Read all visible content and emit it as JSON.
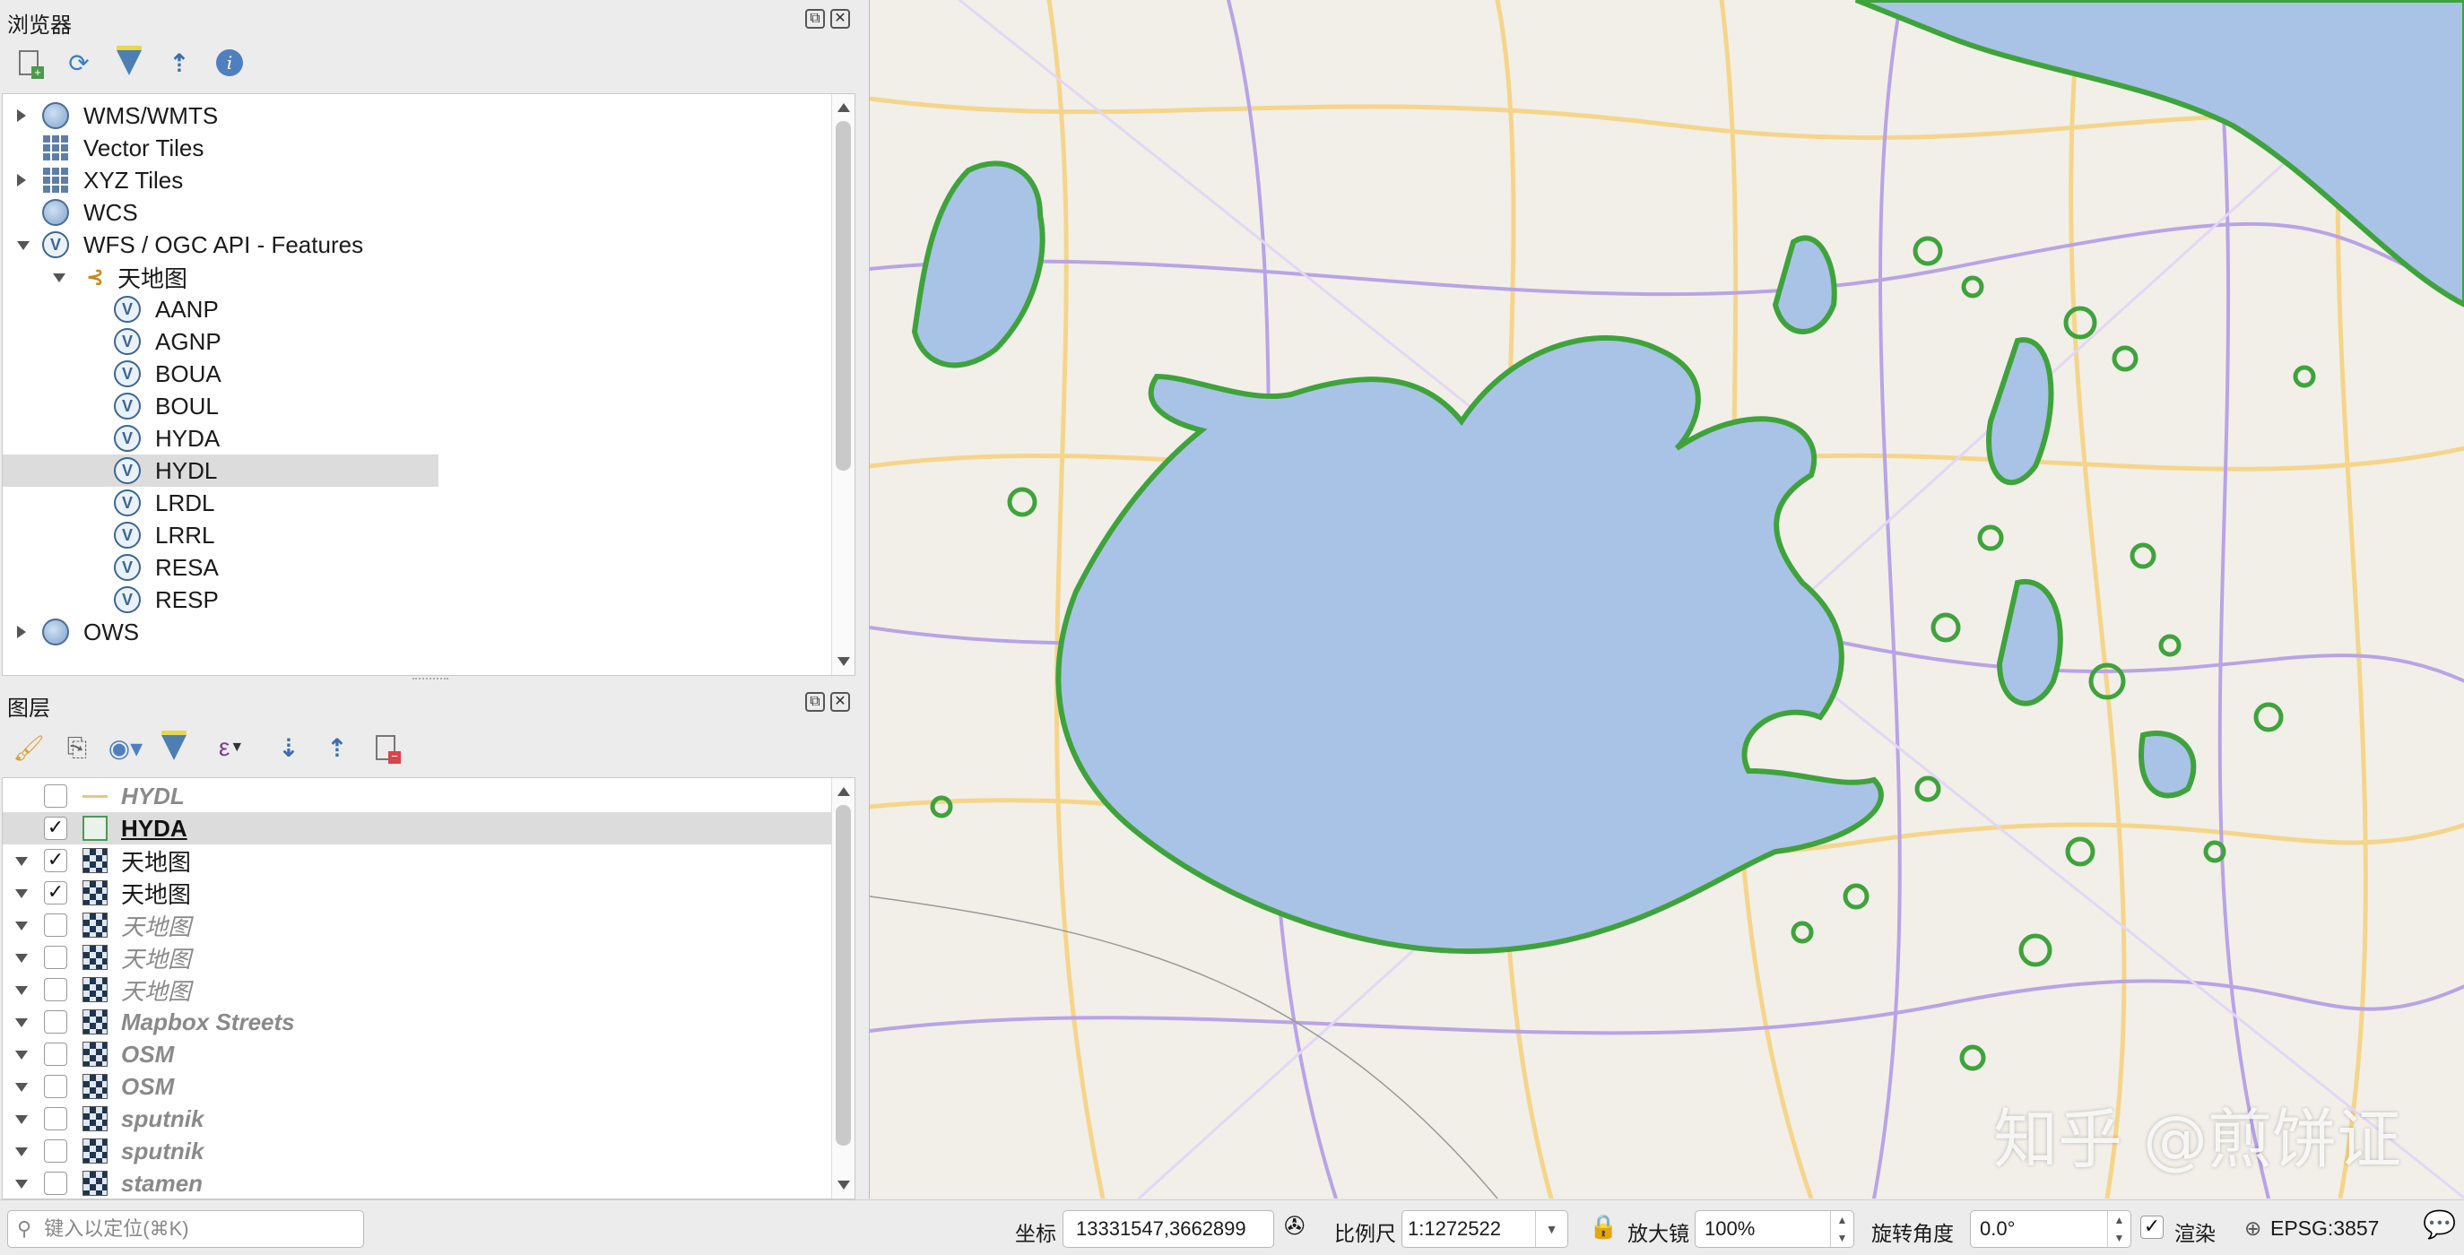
{
  "browser": {
    "title": "浏览器",
    "toolbar": [
      "add-selected-layers-icon",
      "refresh-icon",
      "filter-icon",
      "collapse-all-icon",
      "properties-icon"
    ],
    "items": [
      {
        "label": "WMS/WMTS",
        "icon": "globe",
        "expand": "right",
        "indent": 0
      },
      {
        "label": "Vector Tiles",
        "icon": "grid",
        "expand": "",
        "indent": 0
      },
      {
        "label": "XYZ Tiles",
        "icon": "grid",
        "expand": "right",
        "indent": 0
      },
      {
        "label": "WCS",
        "icon": "globe",
        "expand": "",
        "indent": 0
      },
      {
        "label": "WFS / OGC API - Features",
        "icon": "wfs",
        "expand": "down",
        "indent": 0
      },
      {
        "label": "天地图",
        "icon": "connection",
        "expand": "down",
        "indent": 1
      },
      {
        "label": "AANP",
        "icon": "wfs",
        "indent": 2
      },
      {
        "label": "AGNP",
        "icon": "wfs",
        "indent": 2
      },
      {
        "label": "BOUA",
        "icon": "wfs",
        "indent": 2
      },
      {
        "label": "BOUL",
        "icon": "wfs",
        "indent": 2
      },
      {
        "label": "HYDA",
        "icon": "wfs",
        "indent": 2
      },
      {
        "label": "HYDL",
        "icon": "wfs",
        "indent": 2,
        "selected": true
      },
      {
        "label": "LRDL",
        "icon": "wfs",
        "indent": 2
      },
      {
        "label": "LRRL",
        "icon": "wfs",
        "indent": 2
      },
      {
        "label": "RESA",
        "icon": "wfs",
        "indent": 2
      },
      {
        "label": "RESP",
        "icon": "wfs",
        "indent": 2
      },
      {
        "label": "OWS",
        "icon": "globe",
        "expand": "right",
        "indent": 0
      }
    ]
  },
  "layers": {
    "title": "图层",
    "toolbar": [
      "style-manager-icon",
      "add-group-icon",
      "visibility-icon",
      "filter-legend-icon",
      "expression-filter-icon",
      "expand-all-icon",
      "collapse-all-icon",
      "remove-layer-icon"
    ],
    "items": [
      {
        "label": "HYDL",
        "checked": false,
        "type": "line",
        "style": "italic-bold-gray"
      },
      {
        "label": "HYDA",
        "checked": true,
        "type": "polygon",
        "style": "bold-underline",
        "selected": true
      },
      {
        "label": "天地图",
        "checked": true,
        "type": "raster",
        "style": "normal"
      },
      {
        "label": "天地图",
        "checked": true,
        "type": "raster",
        "style": "normal"
      },
      {
        "label": "天地图",
        "checked": false,
        "type": "raster",
        "style": "italic-gray"
      },
      {
        "label": "天地图",
        "checked": false,
        "type": "raster",
        "style": "italic-gray"
      },
      {
        "label": "天地图",
        "checked": false,
        "type": "raster",
        "style": "italic-gray"
      },
      {
        "label": "Mapbox Streets",
        "checked": false,
        "type": "raster",
        "style": "italic-bold-gray"
      },
      {
        "label": "OSM",
        "checked": false,
        "type": "raster",
        "style": "italic-bold-gray"
      },
      {
        "label": "OSM",
        "checked": false,
        "type": "raster",
        "style": "italic-bold-gray"
      },
      {
        "label": "sputnik",
        "checked": false,
        "type": "raster",
        "style": "italic-bold-gray"
      },
      {
        "label": "sputnik",
        "checked": false,
        "type": "raster",
        "style": "italic-bold-gray"
      },
      {
        "label": "stamen",
        "checked": false,
        "type": "raster",
        "style": "italic-bold-gray"
      }
    ]
  },
  "status": {
    "locator_placeholder": "键入以定位(⌘K)",
    "coord_label": "坐标",
    "coord_value": "13331547,3662899",
    "scale_label": "比例尺",
    "scale_value": "1:1272522",
    "magnifier_label": "放大镜",
    "magnifier_value": "100%",
    "rotation_label": "旋转角度",
    "rotation_value": "0.0°",
    "render_label": "渲染",
    "render_checked": true,
    "crs": "EPSG:3857"
  },
  "map": {
    "watermark": "知乎 @煎饼证",
    "colors": {
      "water": "#a9c3e6",
      "water_outline": "#3fa33c",
      "background": "#f2efe9",
      "motorway": "#b9a3e6",
      "primary": "#f5d58a"
    }
  }
}
